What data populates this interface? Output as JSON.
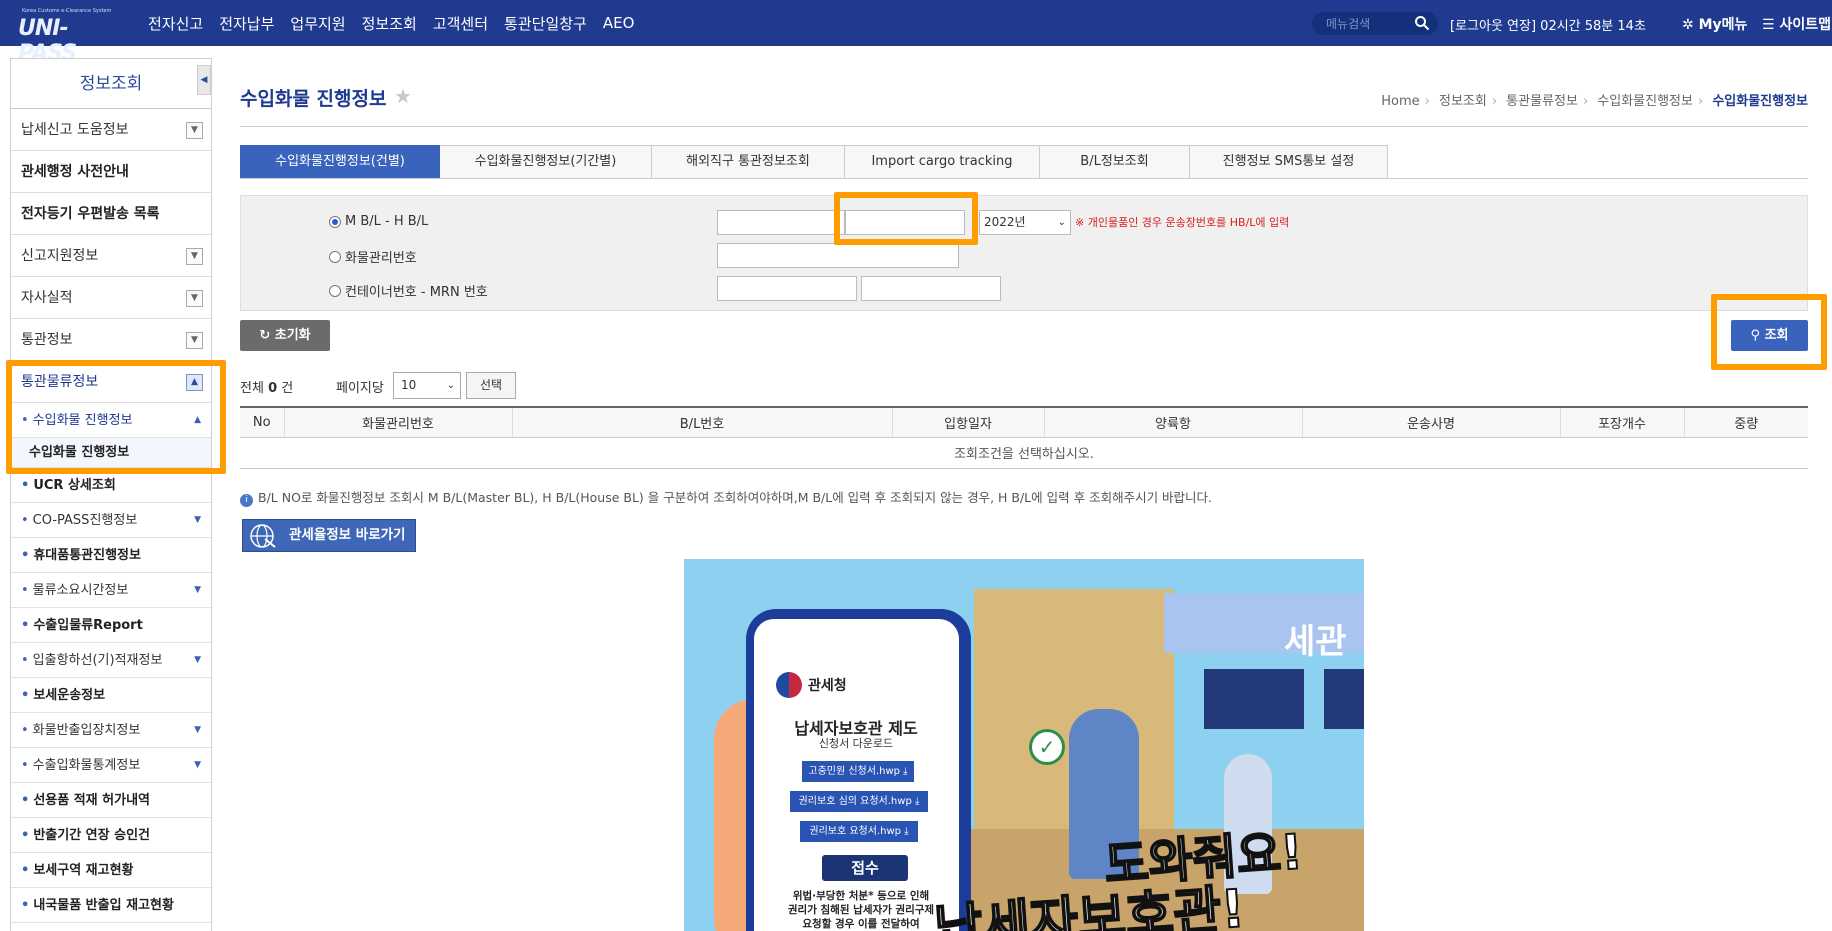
{
  "header": {
    "logo_tagline": "Korea Customs e-Clearance System",
    "logo_text": "UNI-PASS",
    "nav": [
      "전자신고",
      "전자납부",
      "업무지원",
      "정보조회",
      "고객센터",
      "통관단일창구",
      "AEO"
    ],
    "search_placeholder": "메뉴검색",
    "session": "[로그아웃 연장] 02시간 58분 14초",
    "my_menu": "My메뉴",
    "sitemap": "사이트맵"
  },
  "sidebar": {
    "title": "정보조회",
    "items": [
      {
        "label": "납세신고 도움정보",
        "dropdown": true
      },
      {
        "label": "관세행정 사전안내",
        "bold": true
      },
      {
        "label": "전자등기 우편발송 목록",
        "bold": true
      },
      {
        "label": "신고지원정보",
        "dropdown": true
      },
      {
        "label": "자사실적",
        "dropdown": true
      },
      {
        "label": "통관정보",
        "dropdown": true
      },
      {
        "label": "통관물류정보",
        "dropdown": true,
        "expanded": true
      }
    ],
    "sub_items": [
      {
        "label": "수입화물 진행정보",
        "expanded": true
      },
      {
        "label": "UCR 상세조회",
        "bold": true
      },
      {
        "label": "CO-PASS진행정보",
        "has_children": true
      },
      {
        "label": "휴대품통관진행정보",
        "bold": true
      },
      {
        "label": "물류소요시간정보",
        "has_children": true
      },
      {
        "label": "수출입물류Report",
        "bold": true
      },
      {
        "label": "입출항하선(기)적재정보",
        "has_children": true
      },
      {
        "label": "보세운송정보",
        "bold": true
      },
      {
        "label": "화물반출입장치정보",
        "has_children": true
      },
      {
        "label": "수출입화물통계정보",
        "has_children": true
      },
      {
        "label": "선용품 적재 허가내역",
        "bold": true
      },
      {
        "label": "반출기간 연장 승인건",
        "bold": true
      },
      {
        "label": "보세구역 재고현황",
        "bold": true
      },
      {
        "label": "내국물품 반출입 재고현황",
        "bold": true
      }
    ],
    "active_leaf": "수입화물 진행정보"
  },
  "main": {
    "title": "수입화물 진행정보",
    "breadcrumb": [
      "Home",
      "정보조회",
      "통관물류정보",
      "수입화물진행정보",
      "수입화물진행정보"
    ],
    "tabs": [
      "수입화물진행정보(건별)",
      "수입화물진행정보(기간별)",
      "해외직구 통관정보조회",
      "Import cargo tracking",
      "B/L정보조회",
      "진행정보 SMS통보 설정"
    ],
    "form": {
      "radio_bl": "M B/L - H B/L",
      "radio_cargo": "화물관리번호",
      "radio_container": "컨테이너번호 - MRN 번호",
      "year_value": "2022년",
      "note": "※ 개인물품인 경우 운송장번호를 HB/L에 입력"
    },
    "reset_label": "초기화",
    "search_label": "조회",
    "total_prefix": "전체",
    "total_count": "0",
    "total_suffix": "건",
    "per_page_label": "페이지당",
    "per_page_value": "10",
    "select_label": "선택",
    "table": {
      "columns": [
        "No",
        "화물관리번호",
        "B/L번호",
        "입항일자",
        "양륙항",
        "운송사명",
        "포장개수",
        "중량"
      ],
      "empty_message": "조회조건을 선택하십시오."
    },
    "info_text": "B/L NO로 화물진행정보 조회시 M B/L(Master BL), H B/L(House BL) 을 구분하여 조회하여야하며,M B/L에 입력 후 조회되지 않는 경우, H B/L에 입력 후 조회해주시기 바랍니다.",
    "tariff_button": "관세율정보 바로가기"
  },
  "banner": {
    "org": "관세청",
    "title": "납세자보호관 제도",
    "subtitle": "신청서 다운로드",
    "btn1": "고충민원 신청서.hwp ⤓",
    "btn2": "권리보호 심의 요청서.hwp ⤓",
    "btn3": "권리보호 요청서.hwp ⤓",
    "receive": "접수",
    "small1": "위법·부당한 처분* 등으로 인해",
    "small2": "권리가 침해된 납세자가 권리구제",
    "small3": "요청할 경우 이를 전달하여",
    "sign": "세관",
    "big1": "도와줘요!",
    "big2": "납세자보호관!"
  },
  "colors": {
    "header_bg": "#1f3a8f",
    "accent": "#3a63be",
    "highlight": "#ff9d00"
  }
}
